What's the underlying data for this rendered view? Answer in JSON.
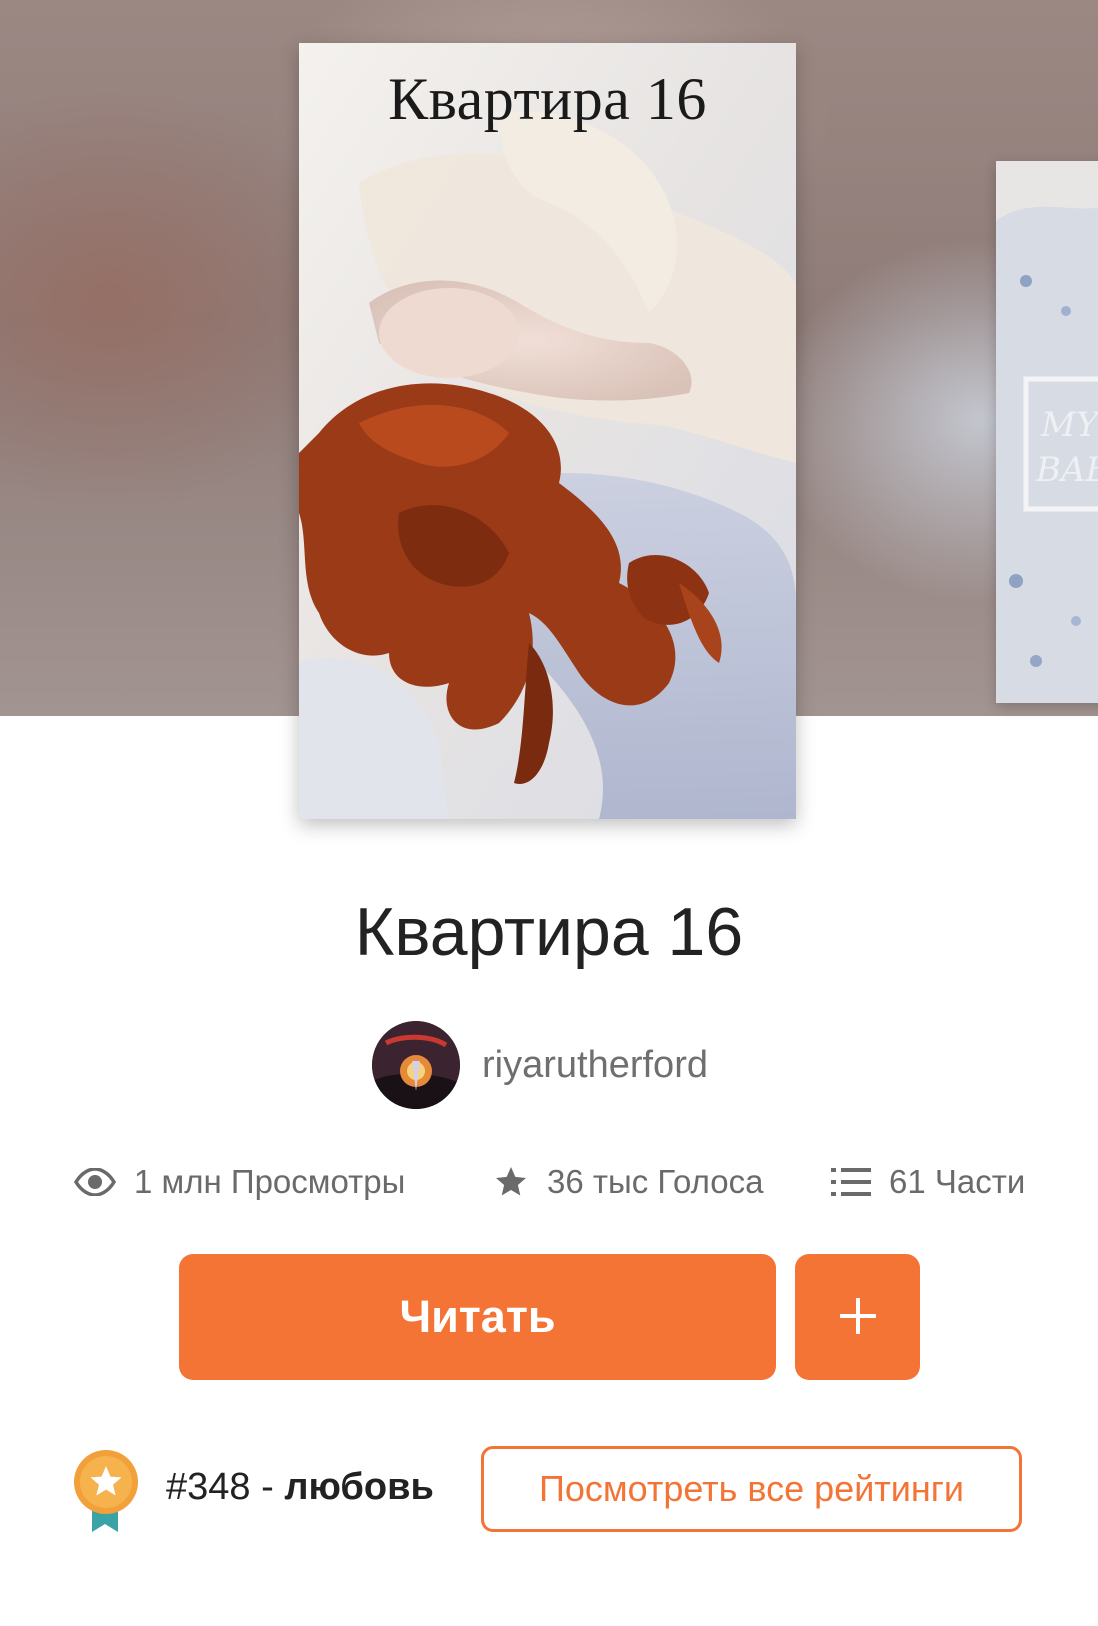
{
  "story": {
    "cover_title": "Квартира 16",
    "title": "Квартира 16",
    "author": "riyarutherford"
  },
  "next_cover": {
    "text_line1": "MY",
    "text_line2": "BAB"
  },
  "stats": {
    "views": "1 млн Просмотры",
    "votes": "36 тыс Голоса",
    "parts": "61 Части",
    "views_icon": "eye-icon",
    "votes_icon": "star-icon",
    "parts_icon": "list-icon"
  },
  "actions": {
    "read_label": "Читать",
    "add_icon": "plus-icon"
  },
  "ranking": {
    "rank": "#348",
    "separator": " - ",
    "tag": "любовь",
    "view_all_label": "Посмотреть все рейтинги",
    "badge_icon": "award-ribbon-icon"
  },
  "colors": {
    "accent": "#f47436",
    "text": "#222222",
    "muted": "#6a6a6a"
  }
}
